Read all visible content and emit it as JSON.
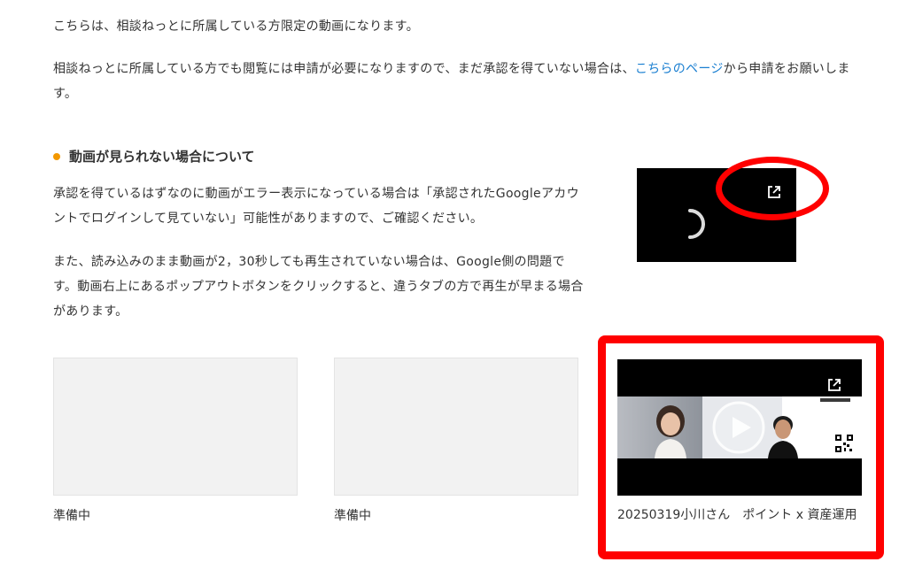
{
  "intro": {
    "line1": "こちらは、相談ねっとに所属している方限定の動画になります。",
    "line2_before": "相談ねっとに所属している方でも閲覧には申請が必要になりますので、まだ承認を得ていない場合は、",
    "line2_link": "こちらのページ",
    "line2_after": "から申請をお願いします。"
  },
  "section": {
    "heading": "動画が見られない場合について",
    "para1": "承認を得ているはずなのに動画がエラー表示になっている場合は「承認されたGoogleアカウントでログインして見ていない」可能性がありますので、ご確認ください。",
    "para2": "また、読み込みのまま動画が2，30秒しても再生されていない場合は、Google側の問題です。動画右上にあるポップアウトボタンをクリックすると、違うタブの方で再生が早まる場合があります。"
  },
  "cards": [
    {
      "label": "準備中"
    },
    {
      "label": "準備中"
    },
    {
      "title": "20250319小川さん　ポイント x 資産運用"
    }
  ],
  "colors": {
    "accent_dot": "#f39800",
    "link": "#1a7fd1",
    "highlight": "#ff0000"
  },
  "icons": {
    "popout": "popout-icon",
    "play": "play-icon",
    "spinner": "loading-spinner-icon"
  }
}
